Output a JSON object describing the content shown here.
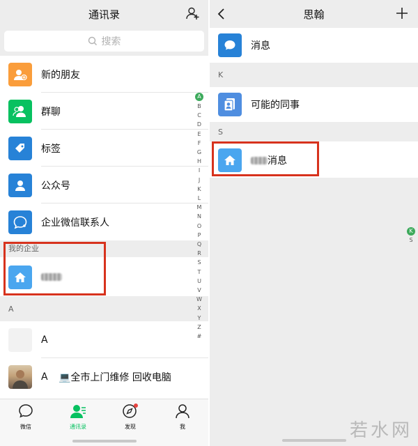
{
  "left": {
    "title": "通讯录",
    "search_placeholder": "搜索",
    "menu_items": [
      {
        "label": "新的朋友",
        "color": "#fa9d3b",
        "icon": "new-friend-icon"
      },
      {
        "label": "群聊",
        "color": "#07c160",
        "icon": "group-chat-icon"
      },
      {
        "label": "标签",
        "color": "#2782d7",
        "icon": "tag-icon"
      },
      {
        "label": "公众号",
        "color": "#2782d7",
        "icon": "official-account-icon"
      },
      {
        "label": "企业微信联系人",
        "color": "#2782d7",
        "icon": "wecom-contact-icon"
      }
    ],
    "enterprise_section": "我的企业",
    "section_a": "A",
    "contacts": [
      {
        "name": "A"
      },
      {
        "name": "A",
        "extra": "💻全市上门维修 回收电脑"
      }
    ],
    "index_letters": [
      "A",
      "B",
      "C",
      "D",
      "E",
      "F",
      "G",
      "H",
      "I",
      "J",
      "K",
      "L",
      "M",
      "N",
      "O",
      "P",
      "Q",
      "R",
      "S",
      "T",
      "U",
      "V",
      "W",
      "X",
      "Y",
      "Z",
      "#"
    ],
    "tabs": [
      {
        "label": "微信"
      },
      {
        "label": "通讯录"
      },
      {
        "label": "发现"
      },
      {
        "label": "我"
      }
    ]
  },
  "right": {
    "title": "思翰",
    "items": [
      {
        "label": "消息"
      },
      {
        "label": "可能的同事"
      },
      {
        "label": "消息"
      }
    ],
    "section_k": "K",
    "section_s": "S",
    "mini_index": [
      "K",
      "S"
    ]
  },
  "watermark": "若水网",
  "colors": {
    "accent": "#07c160",
    "highlight_box": "#d7321d",
    "icon_blue": "#2782d7",
    "index_active": "#3daa5c"
  }
}
